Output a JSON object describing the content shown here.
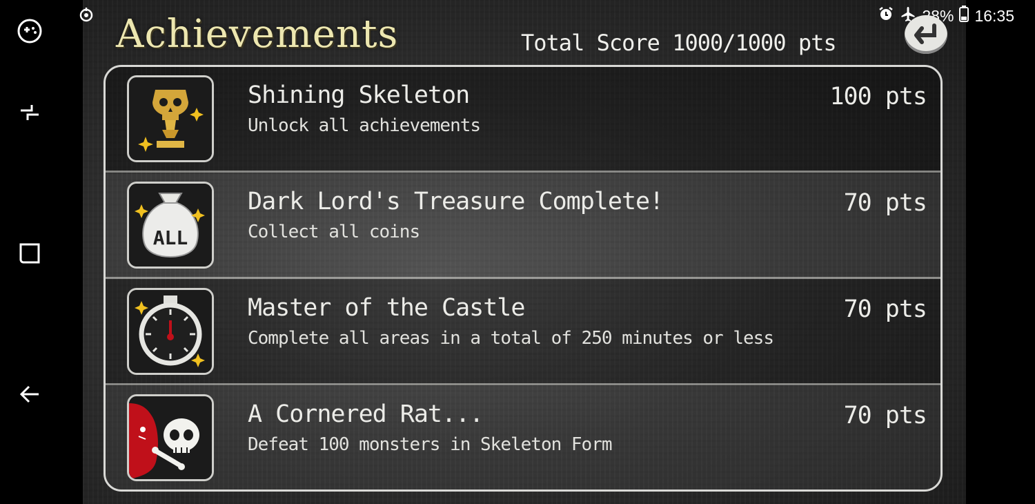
{
  "status_bar": {
    "battery_percent": "28%",
    "time": "16:35",
    "icons": [
      "sync-icon",
      "alarm-icon",
      "airplane-icon",
      "battery-icon"
    ]
  },
  "nav_bar": {
    "buttons": [
      "game-tools-icon",
      "recent-apps-icon",
      "home-icon",
      "back-arrow-icon"
    ]
  },
  "header": {
    "title": "Achievements",
    "total_score": "Total Score 1000/1000 pts",
    "back_icon": "return-arrow-icon"
  },
  "achievements": [
    {
      "name": "Shining Skeleton",
      "description": "Unlock all achievements",
      "points": "100 pts",
      "icon": "golden-skull-trophy-icon"
    },
    {
      "name": "Dark Lord's Treasure Complete!",
      "description": "Collect all coins",
      "points": "70 pts",
      "icon": "coin-bag-icon",
      "icon_text": "ALL"
    },
    {
      "name": "Master of the Castle",
      "description": "Complete all areas in a total of 250 minutes or less",
      "points": "70 pts",
      "icon": "stopwatch-icon"
    },
    {
      "name": "A Cornered Rat...",
      "description": "Defeat 100 monsters in Skeleton Form",
      "points": "70 pts",
      "icon": "skeleton-vs-monster-icon"
    }
  ],
  "colors": {
    "title": "#ede7b0",
    "text": "#ecece8",
    "sparkle": "#f0c020",
    "accent_red": "#c0101a"
  }
}
